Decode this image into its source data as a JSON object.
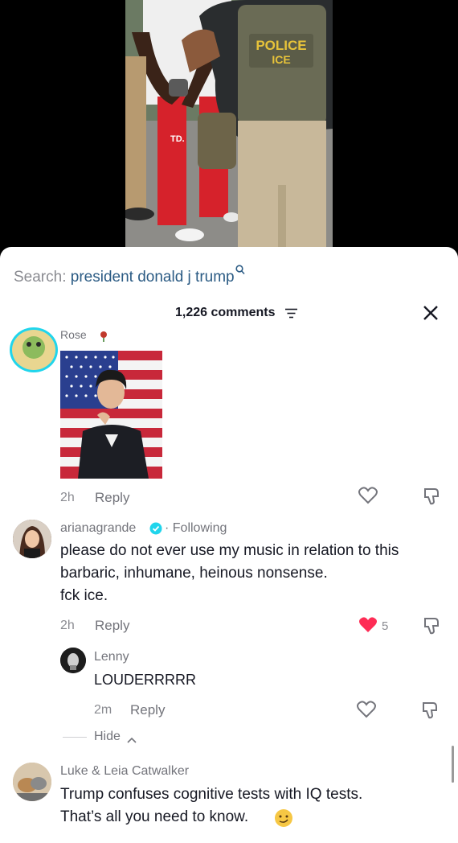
{
  "video": {
    "vest_line1": "POLICE",
    "vest_line2": "ICE",
    "pants_text": "TD."
  },
  "search": {
    "prefix": "Search:",
    "query": "president donald j trump"
  },
  "comments_header": {
    "count_label": "1,226 comments"
  },
  "comments": [
    {
      "author": "Rose",
      "time": "2h",
      "reply_label": "Reply"
    },
    {
      "author": "arianagrande",
      "following": "· Following",
      "text_lines": [
        "please do not ever use my music in relation to this",
        "barbaric, inhumane, heinous nonsense.",
        "fck ice."
      ],
      "time": "2h",
      "reply_label": "Reply",
      "likes": "5",
      "reply": {
        "author": "Lenny",
        "text": "LOUDERRRRR",
        "time": "2m",
        "reply_label": "Reply"
      },
      "hide_label": "Hide"
    },
    {
      "author": "Luke & Leia Catwalker",
      "text_lines": [
        "Trump confuses cognitive tests with IQ tests.",
        "That’s all you need to know."
      ]
    }
  ],
  "colors": {
    "like_active": "#fe2c55",
    "verified": "#20d5ec",
    "link": "#2b5b84"
  }
}
